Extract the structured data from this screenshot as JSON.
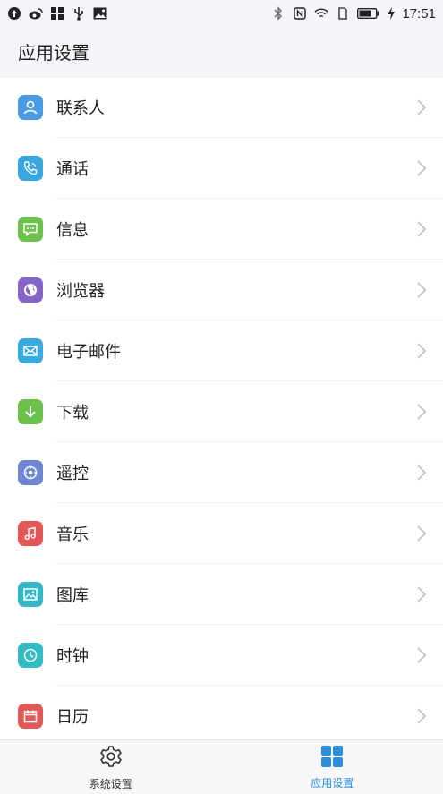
{
  "status_bar": {
    "time": "17:51"
  },
  "header": {
    "title": "应用设置"
  },
  "settings_items": [
    {
      "label": "联系人",
      "icon": "contacts-icon",
      "color": "#4a9be6"
    },
    {
      "label": "通话",
      "icon": "phone-icon",
      "color": "#3aa6e0"
    },
    {
      "label": "信息",
      "icon": "message-icon",
      "color": "#6dc14c"
    },
    {
      "label": "浏览器",
      "icon": "browser-icon",
      "color": "#8563c8"
    },
    {
      "label": "电子邮件",
      "icon": "email-icon",
      "color": "#39aadf"
    },
    {
      "label": "下载",
      "icon": "download-icon",
      "color": "#6cc14a"
    },
    {
      "label": "遥控",
      "icon": "remote-icon",
      "color": "#6f86d6"
    },
    {
      "label": "音乐",
      "icon": "music-icon",
      "color": "#e55757"
    },
    {
      "label": "图库",
      "icon": "gallery-icon",
      "color": "#36b7c6"
    },
    {
      "label": "时钟",
      "icon": "clock-icon",
      "color": "#2fbdc3"
    },
    {
      "label": "日历",
      "icon": "calendar-icon",
      "color": "#e05a5a"
    }
  ],
  "bottom_nav": {
    "tabs": [
      {
        "label": "系统设置",
        "icon": "gear-icon",
        "active": false
      },
      {
        "label": "应用设置",
        "icon": "grid-icon",
        "active": true
      }
    ],
    "active_color": "#2b8fdc"
  }
}
